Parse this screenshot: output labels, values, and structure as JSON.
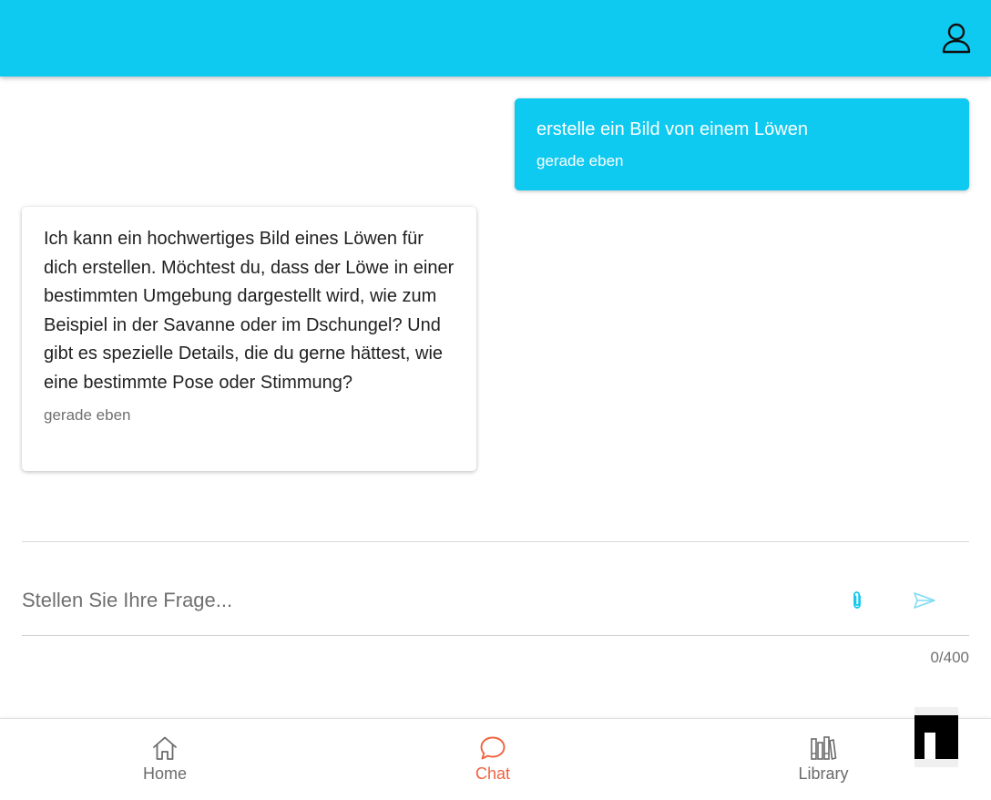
{
  "header": {
    "profile_icon": "user-icon",
    "background": "#0ec9f0"
  },
  "messages": [
    {
      "role": "user",
      "text": "erstelle ein Bild von einem Löwen",
      "time": "gerade eben"
    },
    {
      "role": "assistant",
      "text": "Ich kann ein hochwertiges Bild eines Löwen für dich erstellen. Möchtest du, dass der Löwe in einer bestimmten Umgebung dargestellt wird, wie zum Beispiel in der Savanne oder im Dschungel? Und gibt es spezielle Details, die du gerne hättest, wie eine bestimmte Pose oder Stimmung?",
      "time": "gerade eben"
    }
  ],
  "composer": {
    "placeholder": "Stellen Sie Ihre Frage...",
    "value": "",
    "counter": "0/400",
    "attach_icon": "paperclip-icon",
    "send_icon": "send-icon"
  },
  "nav": {
    "items": [
      {
        "label": "Home",
        "icon": "home-icon",
        "active": false
      },
      {
        "label": "Chat",
        "icon": "chat-bubble-icon",
        "active": true
      },
      {
        "label": "Library",
        "icon": "library-icon",
        "active": false
      }
    ],
    "active_color": "#f0623e",
    "inactive_color": "#6b6b6b"
  }
}
